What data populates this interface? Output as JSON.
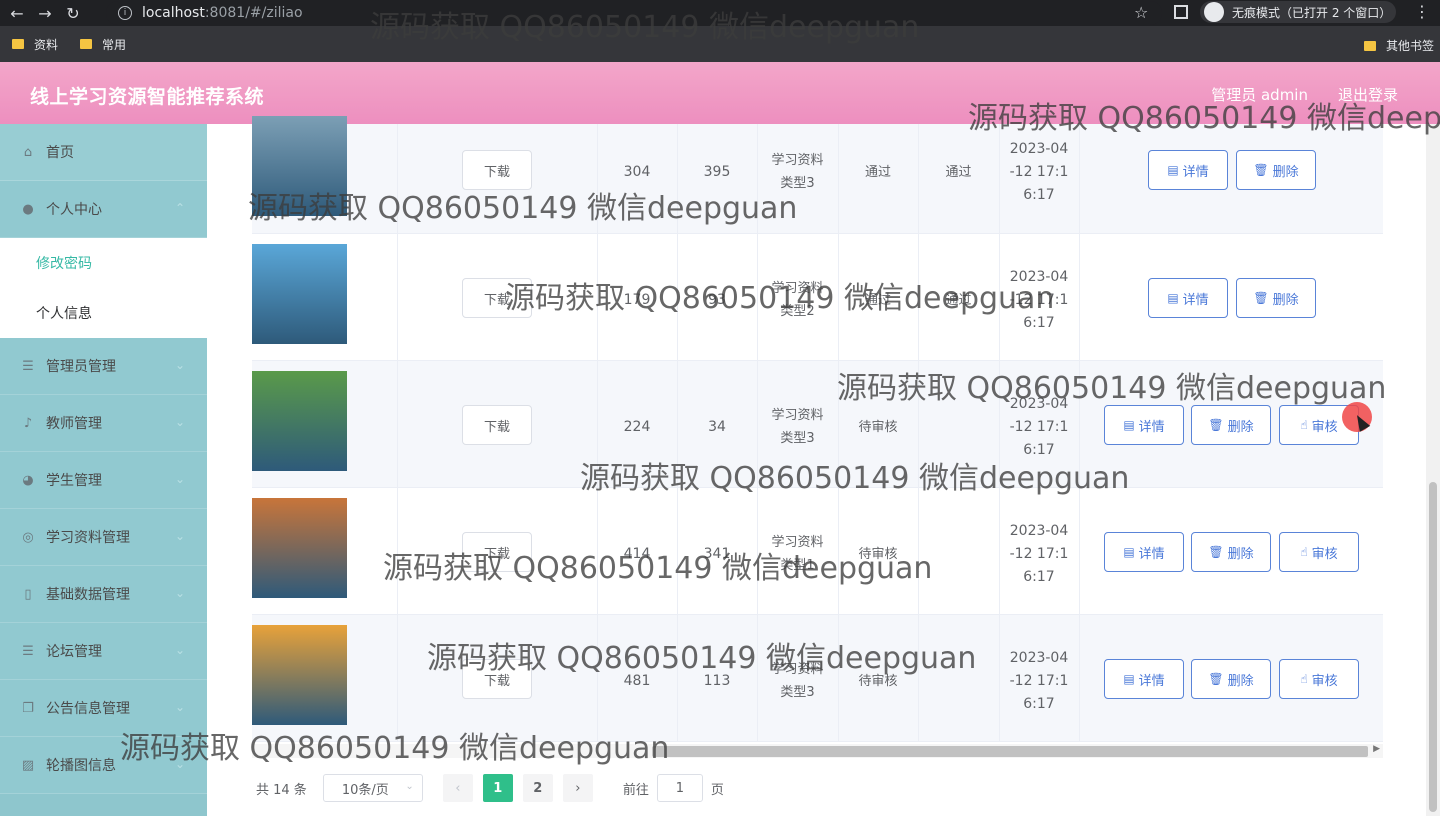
{
  "browser": {
    "url_host": "localhost",
    "url_rest": ":8081/#/ziliao",
    "incognito_label": "无痕模式（已打开 2 个窗口）",
    "bookmarks": [
      "资料",
      "常用"
    ],
    "other_bookmarks": "其他书签"
  },
  "header": {
    "title": "线上学习资源智能推荐系统",
    "user": "管理员 admin",
    "logout": "退出登录"
  },
  "sidebar": {
    "items": [
      {
        "label": "首页",
        "icon": "home-icon"
      },
      {
        "label": "个人中心",
        "icon": "user-icon"
      },
      {
        "label": "管理员管理",
        "icon": "list-icon"
      },
      {
        "label": "教师管理",
        "icon": "mic-icon"
      },
      {
        "label": "学生管理",
        "icon": "palette-icon"
      },
      {
        "label": "学习资料管理",
        "icon": "compass-icon"
      },
      {
        "label": "基础数据管理",
        "icon": "phone-icon"
      },
      {
        "label": "论坛管理",
        "icon": "list-icon"
      },
      {
        "label": "公告信息管理",
        "icon": "copy-icon"
      },
      {
        "label": "轮播图信息",
        "icon": "picture-icon"
      }
    ],
    "sub_items": [
      {
        "label": "修改密码",
        "active": true
      },
      {
        "label": "个人信息",
        "active": false
      }
    ]
  },
  "table": {
    "download_label": "下载",
    "detail_label": "详情",
    "delete_label": "删除",
    "review_label": "审核",
    "rows": [
      {
        "c1": "304",
        "c2": "395",
        "type1": "学习资料",
        "type2": "类型3",
        "s1": "通过",
        "s2": "通过",
        "t1": "2023-04",
        "t2": "-12 17:1",
        "t3": "6:17",
        "review": false,
        "thumb": "#7c9fb5"
      },
      {
        "c1": "179",
        "c2": "93",
        "type1": "学习资料",
        "type2": "类型2",
        "s1": "通过",
        "s2": "通过",
        "t1": "2023-04",
        "t2": "-12 17:1",
        "t3": "6:17",
        "review": false,
        "thumb": "#5aa7d8"
      },
      {
        "c1": "224",
        "c2": "34",
        "type1": "学习资料",
        "type2": "类型3",
        "s1": "待审核",
        "s2": "",
        "t1": "2023-04",
        "t2": "-12 17:1",
        "t3": "6:17",
        "review": true,
        "thumb": "#5a9a4a"
      },
      {
        "c1": "414",
        "c2": "341",
        "type1": "学习资料",
        "type2": "类型1",
        "s1": "待审核",
        "s2": "",
        "t1": "2023-04",
        "t2": "-12 17:1",
        "t3": "6:17",
        "review": true,
        "thumb": "#c8753a"
      },
      {
        "c1": "481",
        "c2": "113",
        "type1": "学习资料",
        "type2": "类型3",
        "s1": "待审核",
        "s2": "",
        "t1": "2023-04",
        "t2": "-12 17:1",
        "t3": "6:17",
        "review": true,
        "thumb": "#e8a23a"
      }
    ]
  },
  "pager": {
    "total": "共 14 条",
    "size": "10条/页",
    "pages": [
      "1",
      "2"
    ],
    "goto_prefix": "前往",
    "goto_value": "1",
    "goto_suffix": "页"
  },
  "watermark": "源码获取 QQ86050149 微信deepguan"
}
